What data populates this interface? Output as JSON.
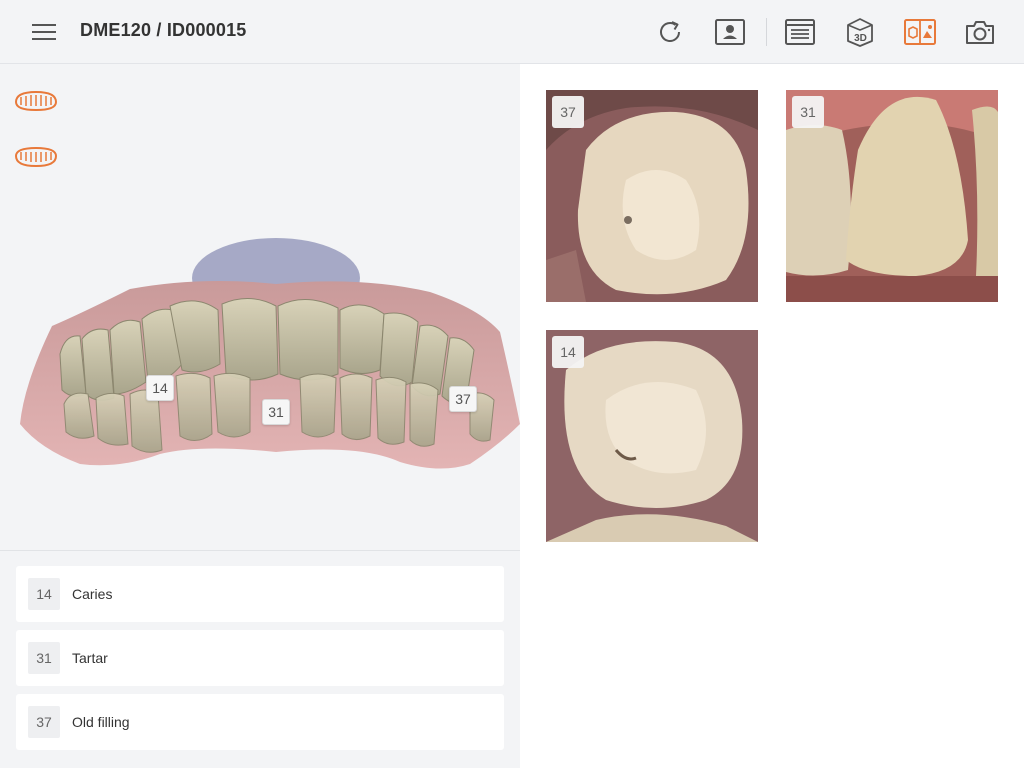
{
  "header": {
    "title": "DME120 / ID000015",
    "accent_color": "#e8793a",
    "icons": [
      "menu-icon",
      "refresh-icon",
      "patient-icon",
      "list-view-icon",
      "3d-view-icon",
      "3d-photo-view-icon",
      "camera-icon"
    ],
    "icon_3d_text": "3D"
  },
  "left_panel": {
    "jaw_buttons": [
      "upper-jaw-icon",
      "lower-jaw-icon"
    ],
    "tooth_tags": [
      "14",
      "31",
      "37"
    ],
    "findings": [
      {
        "tooth": "14",
        "label": "Caries"
      },
      {
        "tooth": "31",
        "label": "Tartar"
      },
      {
        "tooth": "37",
        "label": "Old filling"
      }
    ]
  },
  "photos": [
    {
      "tooth": "37"
    },
    {
      "tooth": "31"
    },
    {
      "tooth": "14"
    }
  ]
}
